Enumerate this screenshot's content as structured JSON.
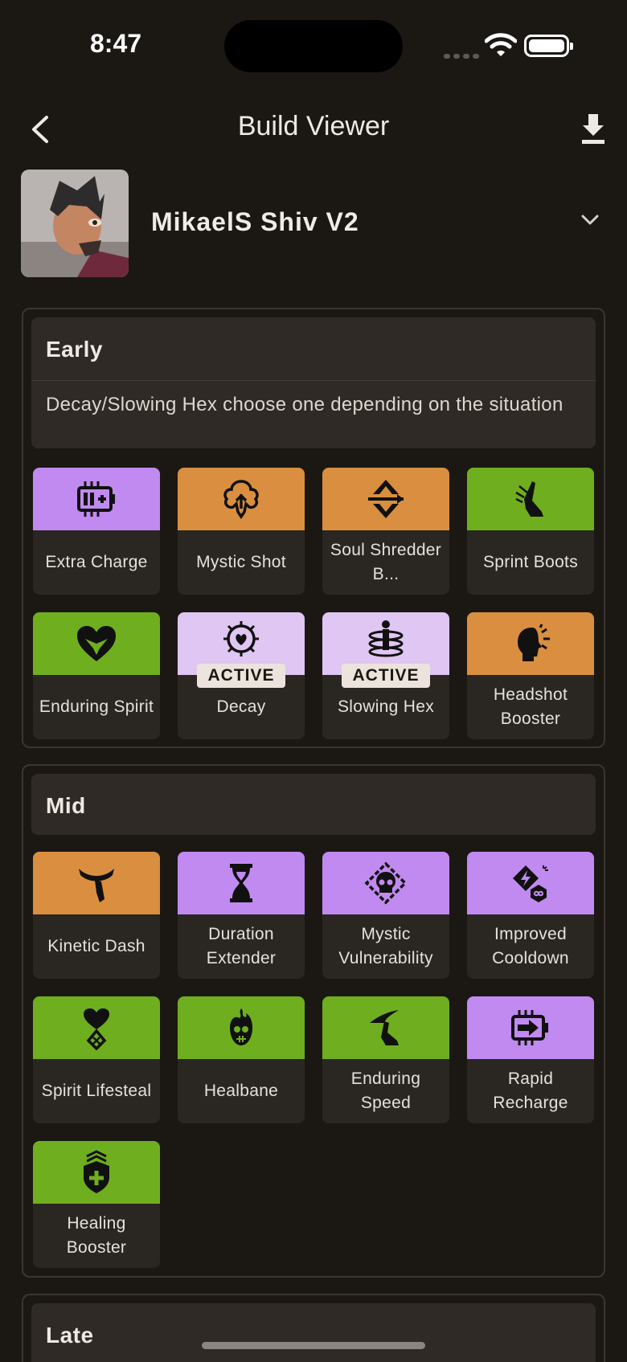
{
  "status": {
    "time": "8:47"
  },
  "header": {
    "title": "Build Viewer"
  },
  "build": {
    "name": "MikaelS Shiv V2"
  },
  "sections": {
    "early": {
      "title": "Early",
      "note": "Decay/Slowing Hex choose one depending on the situation",
      "items": [
        {
          "label": "Extra Charge",
          "color": "purple",
          "icon": "battery-charge-icon"
        },
        {
          "label": "Mystic Shot",
          "color": "orange",
          "icon": "mystic-shot-icon"
        },
        {
          "label": "Soul Shredder B...",
          "color": "orange",
          "icon": "soul-shredder-icon"
        },
        {
          "label": "Sprint Boots",
          "color": "green",
          "icon": "boot-icon"
        },
        {
          "label": "Enduring Spirit",
          "color": "green",
          "icon": "heart-spirit-icon"
        },
        {
          "label": "Decay",
          "color": "lavender",
          "icon": "decay-icon",
          "badge": "ACTIVE"
        },
        {
          "label": "Slowing Hex",
          "color": "lavender",
          "icon": "slowing-hex-icon",
          "badge": "ACTIVE"
        },
        {
          "label": "Headshot Booster",
          "color": "orange",
          "icon": "headshot-icon"
        }
      ]
    },
    "mid": {
      "title": "Mid",
      "items": [
        {
          "label": "Kinetic Dash",
          "color": "orange",
          "icon": "scarf-icon"
        },
        {
          "label": "Duration Extender",
          "color": "purple",
          "icon": "hourglass-icon"
        },
        {
          "label": "Mystic Vulnerability",
          "color": "purple",
          "icon": "skull-diamond-icon"
        },
        {
          "label": "Improved Cooldown",
          "color": "purple",
          "icon": "cooldown-icon"
        },
        {
          "label": "Spirit Lifesteal",
          "color": "green",
          "icon": "heart-drop-icon"
        },
        {
          "label": "Healbane",
          "color": "green",
          "icon": "skull-flame-icon"
        },
        {
          "label": "Enduring Speed",
          "color": "green",
          "icon": "winged-boot-icon"
        },
        {
          "label": "Rapid Recharge",
          "color": "purple",
          "icon": "battery-arrow-icon"
        },
        {
          "label": "Healing Booster",
          "color": "green",
          "icon": "shield-plus-icon"
        }
      ]
    },
    "late": {
      "title": "Late"
    }
  },
  "colors": {
    "purple": "#c18af0",
    "orange": "#d98f3f",
    "green": "#6fae1f",
    "lavender": "#e0c6f2",
    "background": "#1b1814"
  }
}
